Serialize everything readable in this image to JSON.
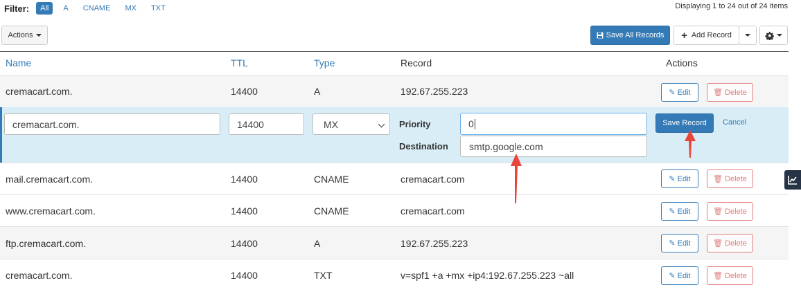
{
  "filter": {
    "label": "Filter:",
    "options": [
      "All",
      "A",
      "CNAME",
      "MX",
      "TXT"
    ],
    "active": "All"
  },
  "display_info": "Displaying 1 to 24 out of 24 items",
  "toolbar": {
    "actions_label": "Actions",
    "save_all_label": "Save All Records",
    "add_record_label": "Add Record",
    "gear_icon": "gear-icon"
  },
  "table": {
    "headers": {
      "name": "Name",
      "ttl": "TTL",
      "type": "Type",
      "record": "Record",
      "actions": "Actions"
    },
    "edit_label": "Edit",
    "delete_label": "Delete",
    "rows": [
      {
        "name": "cremacart.com.",
        "ttl": "14400",
        "type": "A",
        "record": "192.67.255.223"
      },
      {
        "name": "mail.cremacart.com.",
        "ttl": "14400",
        "type": "CNAME",
        "record": "cremacart.com"
      },
      {
        "name": "www.cremacart.com.",
        "ttl": "14400",
        "type": "CNAME",
        "record": "cremacart.com"
      },
      {
        "name": "ftp.cremacart.com.",
        "ttl": "14400",
        "type": "A",
        "record": "192.67.255.223"
      },
      {
        "name": "cremacart.com.",
        "ttl": "14400",
        "type": "TXT",
        "record": "v=spf1 +a +mx +ip4:192.67.255.223 ~all"
      }
    ]
  },
  "editing_row": {
    "name_value": "cremacart.com.",
    "ttl_value": "14400",
    "type_selected": "MX",
    "priority_label": "Priority",
    "priority_value": "0",
    "destination_label": "Destination",
    "destination_value": "smtp.google.com",
    "save_label": "Save Record",
    "cancel_label": "Cancel"
  },
  "colors": {
    "primary": "#337ab7",
    "danger": "#d9534f",
    "edit_bg": "#d9edf7",
    "arrow": "#e8463a"
  }
}
